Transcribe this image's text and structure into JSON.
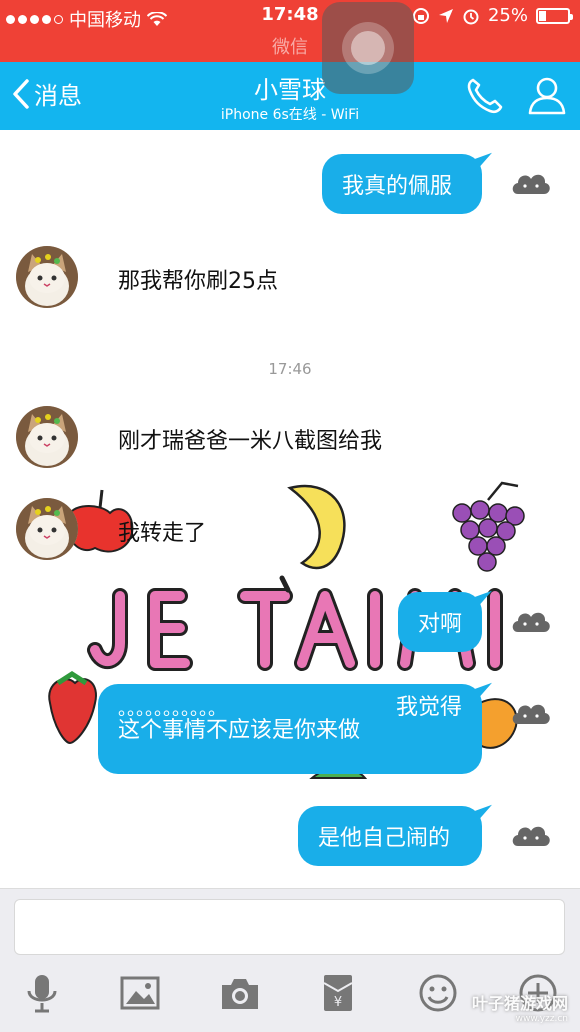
{
  "status": {
    "carrier": "中国移动",
    "time": "17:48",
    "battery": "25%",
    "battery_level": 0.25,
    "subtitle": "微信"
  },
  "header": {
    "back_label": "消息",
    "title": "小雪球",
    "subtitle": "iPhone 6s在线 - WiFi",
    "call_icon": "phone-icon",
    "profile_icon": "user-icon"
  },
  "messages": [
    {
      "side": "right",
      "text": "我真的佩服"
    },
    {
      "side": "left",
      "text": "那我帮你刷25点"
    },
    {
      "type": "time",
      "text": "17:46"
    },
    {
      "side": "left",
      "text": "刚才瑞爸爸一米八截图给我"
    },
    {
      "side": "left",
      "text": "我转走了"
    },
    {
      "type": "sticker",
      "text": "JE TAIME"
    },
    {
      "side": "right",
      "text": "对啊"
    },
    {
      "side": "right",
      "text": "我觉得",
      "line2": "。。。。。。。。。。。",
      "line3": "这个事情不应该是你来做"
    },
    {
      "side": "right",
      "text": "是他自己闹的"
    }
  ],
  "toolbar": [
    "voice-icon",
    "image-icon",
    "camera-icon",
    "red-packet-icon",
    "emoji-icon",
    "plus-icon"
  ],
  "watermark": {
    "main": "叶子猪游戏网",
    "sub": "www.yzz.cn"
  },
  "colors": {
    "status_bar": "#ef4136",
    "header": "#13b5ef",
    "bubble": "#19aee9"
  }
}
